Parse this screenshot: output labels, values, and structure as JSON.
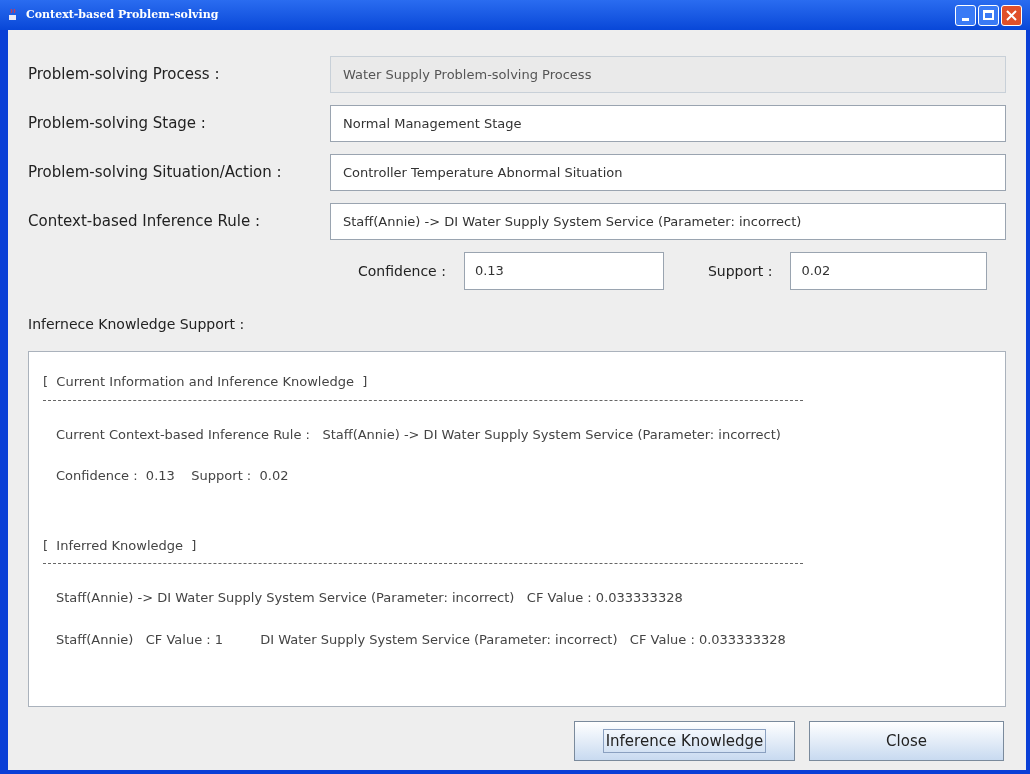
{
  "window": {
    "title": "Context-based Problem-solving"
  },
  "fields": [
    {
      "label": "Problem-solving Process :",
      "value": "Water Supply Problem-solving Process",
      "disabled": true
    },
    {
      "label": "Problem-solving Stage :",
      "value": "Normal Management Stage",
      "disabled": false
    },
    {
      "label": "Problem-solving Situation/Action :",
      "value": "Controller Temperature Abnormal Situation",
      "disabled": false
    },
    {
      "label": "Context-based Inference Rule :",
      "value": "Staff(Annie) -> DI Water Supply System Service (Parameter: incorrect)",
      "disabled": false
    }
  ],
  "metrics": [
    {
      "label": "Confidence :",
      "value": "0.13"
    },
    {
      "label": "Support :",
      "value": "0.02"
    }
  ],
  "support_label": "Infernece Knowledge Support :",
  "output": [
    {
      "kind": "heading",
      "text": "[  Current Information and Inference Knowledge  ]"
    },
    {
      "kind": "line",
      "text": "Current Context-based Inference Rule :   Staff(Annie) -> DI Water Supply System Service (Parameter: incorrect)"
    },
    {
      "kind": "line",
      "text": "Confidence :  0.13    Support :  0.02"
    },
    {
      "kind": "heading",
      "text": "[  Inferred Knowledge  ]"
    },
    {
      "kind": "line",
      "text": "Staff(Annie) -> DI Water Supply System Service (Parameter: incorrect)   CF Value : 0.033333328"
    },
    {
      "kind": "line",
      "text": "Staff(Annie)   CF Value : 1         DI Water Supply System Service (Parameter: incorrect)   CF Value : 0.033333328"
    }
  ],
  "buttons": [
    {
      "label": "Inference Knowledge",
      "focused": true
    },
    {
      "label": "Close",
      "focused": false
    }
  ]
}
